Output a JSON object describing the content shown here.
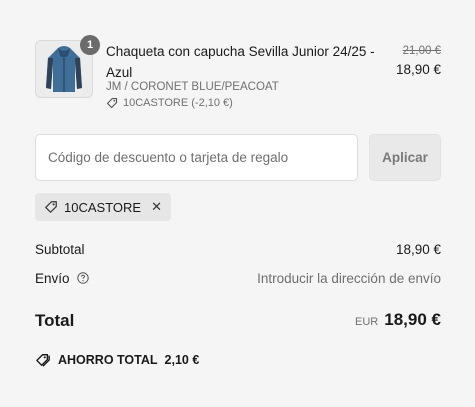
{
  "product": {
    "image_icon": "jacket-icon",
    "quantity": "1",
    "name": "Chaqueta con capucha Sevilla Junior 24/25 - Azul",
    "variant": "JM / CORONET BLUE/PEACOAT",
    "discount": "10CASTORE (-2,10 €)",
    "original_price": "21,00 €",
    "price": "18,90 €"
  },
  "discount_form": {
    "placeholder": "Código de descuento o tarjeta de regalo",
    "value": "",
    "apply_label": "Aplicar"
  },
  "applied_code": {
    "code": "10CASTORE",
    "remove_symbol": "✕"
  },
  "summary": {
    "subtotal_label": "Subtotal",
    "subtotal_value": "18,90 €",
    "shipping_label": "Envío",
    "shipping_value": "Introducir la dirección de envío",
    "total_label": "Total",
    "currency": "EUR",
    "total_value": "18,90 €",
    "savings_label": "AHORRO TOTAL",
    "savings_value": "2,10 €"
  },
  "colors": {
    "background": "#f5f5f5",
    "text": "#1a1a1a",
    "muted": "#707070",
    "jacket": "#3f6f99"
  }
}
